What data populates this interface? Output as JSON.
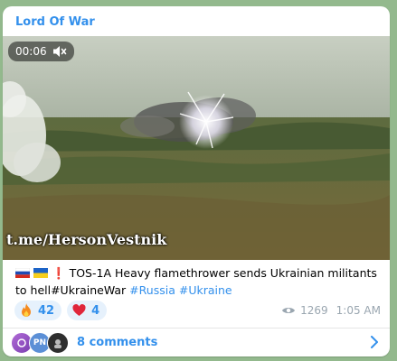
{
  "channel": {
    "name": "Lord Of War"
  },
  "video": {
    "time": "00:06",
    "watermark": "t.me/HersonVestnik"
  },
  "message": {
    "text": "TOS-1A Heavy flamethrower sends Ukrainian militants to hell#UkraineWar",
    "hashtags": [
      "#Russia",
      "#Ukraine"
    ],
    "icons": [
      "russia-flag-icon",
      "ukraine-flag-icon",
      "red-exclamation-icon"
    ]
  },
  "reactions": [
    {
      "icon": "fire-icon",
      "count": "42"
    },
    {
      "icon": "heart-icon",
      "count": "4"
    }
  ],
  "meta": {
    "views": "1269",
    "time": "1:05 AM"
  },
  "comments": {
    "label": "8 comments",
    "avatar_initials": [
      "PN"
    ]
  },
  "colors": {
    "accent": "#3390ec",
    "card": "#ffffff",
    "chat_background": "#93b98d"
  }
}
